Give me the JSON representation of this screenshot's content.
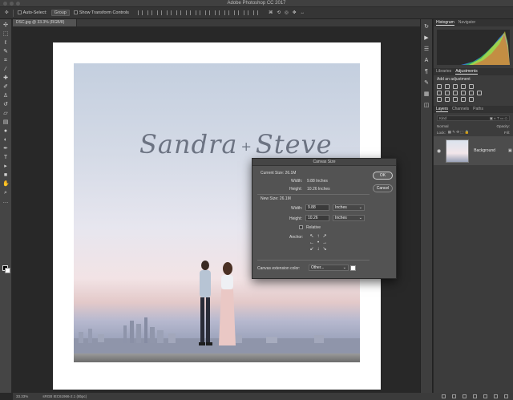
{
  "app": {
    "title": "Adobe Photoshop CC 2017"
  },
  "options_bar": {
    "auto_select_label": "Auto-Select:",
    "auto_select_value": "Group",
    "show_transform_label": "Show Transform Controls"
  },
  "document": {
    "tab_label": "DSC.jpg @ 33.3% (RGB/8)"
  },
  "canvas_text": {
    "name_left": "Sandra",
    "name_right": "Steve",
    "joiner": "+"
  },
  "status_bar": {
    "zoom": "33.33%",
    "doc_info": "sRGB IEC61966-2.1 (8bpc)"
  },
  "right_panel": {
    "histogram_tab": "Histogram",
    "navigator_tab": "Navigator",
    "libraries_tab": "Libraries",
    "adjustments_tab": "Adjustments",
    "add_adjustment": "Add an adjustment",
    "layers_tab": "Layers",
    "channels_tab": "Channels",
    "paths_tab": "Paths",
    "kind_label": "Kind",
    "mode_value": "Normal",
    "opacity_label": "Opacity:",
    "lock_label": "Lock:",
    "fill_label": "Fill:",
    "layer_name": "Background"
  },
  "dialog": {
    "title": "Canvas Size",
    "current_size_label": "Current Size: 26.1M",
    "current_width_label": "Width:",
    "current_width_value": "9.88 Inches",
    "current_height_label": "Height:",
    "current_height_value": "10.26 Inches",
    "new_size_label": "New Size: 26.1M",
    "new_width_label": "Width:",
    "new_width_value": "9.88",
    "new_height_label": "Height:",
    "new_height_value": "10.26",
    "unit_width": "Inches",
    "unit_height": "Inches",
    "relative_label": "Relative",
    "anchor_label": "Anchor:",
    "extension_label": "Canvas extension color:",
    "extension_value": "Other...",
    "ok_label": "OK",
    "cancel_label": "Cancel"
  }
}
